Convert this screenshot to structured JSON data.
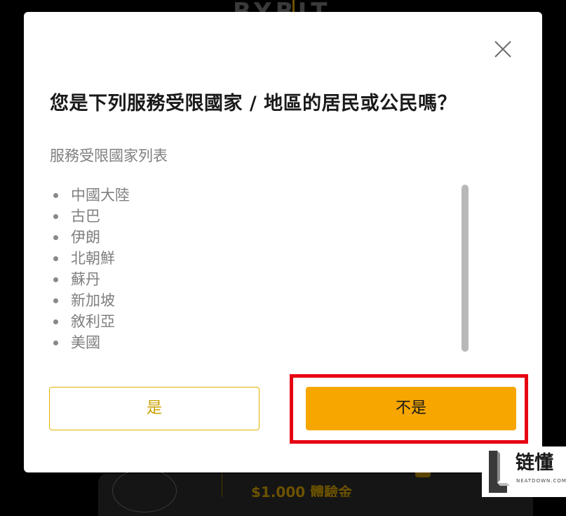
{
  "background": {
    "logo_text": "BYBIT",
    "promo_amount": "$1,000 體驗金"
  },
  "modal": {
    "title": "您是下列服務受限國家 / 地區的居民或公民嗎？",
    "list_heading": "服務受限國家列表",
    "countries": [
      "中國大陸",
      "古巴",
      "伊朗",
      "北朝鮮",
      "蘇丹",
      "新加坡",
      "敘利亞",
      "美國"
    ],
    "yes_label": "是",
    "no_label": "不是",
    "close_icon": "close-icon"
  },
  "watermark": {
    "name": "链懂",
    "site": "NEATDOWN.COM"
  },
  "colors": {
    "accent": "#f7a600",
    "highlight": "#e60012",
    "muted_text": "#7f7f7f"
  }
}
